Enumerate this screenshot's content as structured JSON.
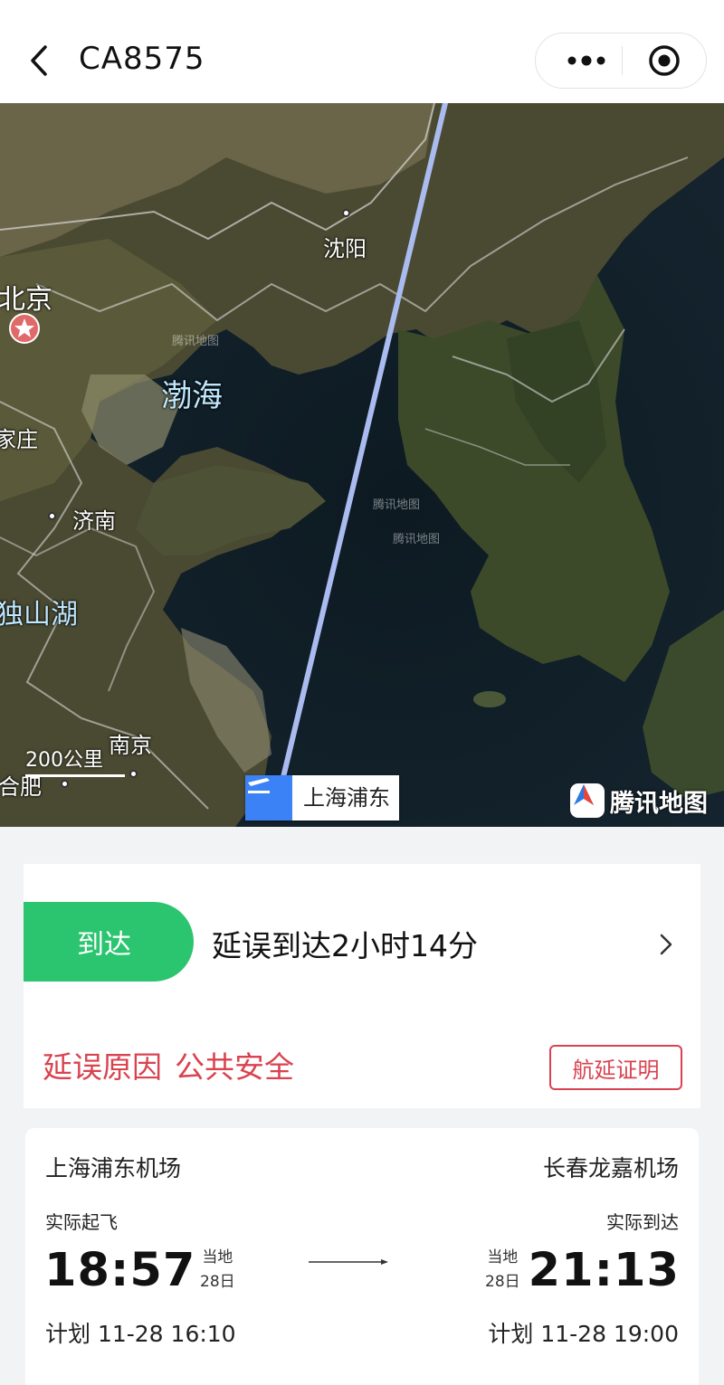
{
  "header": {
    "title": "CA8575",
    "back_icon": "chevron-left-icon",
    "more_icon": "more-dots-icon",
    "target_icon": "record-target-icon"
  },
  "map": {
    "labels": {
      "shenyang": "沈阳",
      "beijing": "北京",
      "bohai": "渤海",
      "shijiazhuang": "家庄",
      "jinan": "济南",
      "dushanhu": "独山湖",
      "nanjing": "南京",
      "hefei": "合肥"
    },
    "scale": "200公里",
    "watermark": "腾讯地图",
    "departure_tag": "上海浦东",
    "provider_logo": "腾讯地图",
    "route_color": "#aabbf0"
  },
  "status": {
    "badge": "到达",
    "badge_color": "#2bc46f",
    "text": "延误到达2小时14分",
    "reason_label": "延误原因",
    "reason_value": "公共安全",
    "reason_color": "#d9434f",
    "certificate_button": "航延证明"
  },
  "flight": {
    "origin": {
      "airport": "上海浦东机场",
      "label": "实际起飞",
      "time": "18:57",
      "local_label": "当地",
      "local_date": "28日",
      "plan": "计划 11-28 16:10"
    },
    "destination": {
      "airport": "长春龙嘉机场",
      "label": "实际到达",
      "time": "21:13",
      "local_label": "当地",
      "local_date": "28日",
      "plan": "计划 11-28 19:00"
    }
  }
}
